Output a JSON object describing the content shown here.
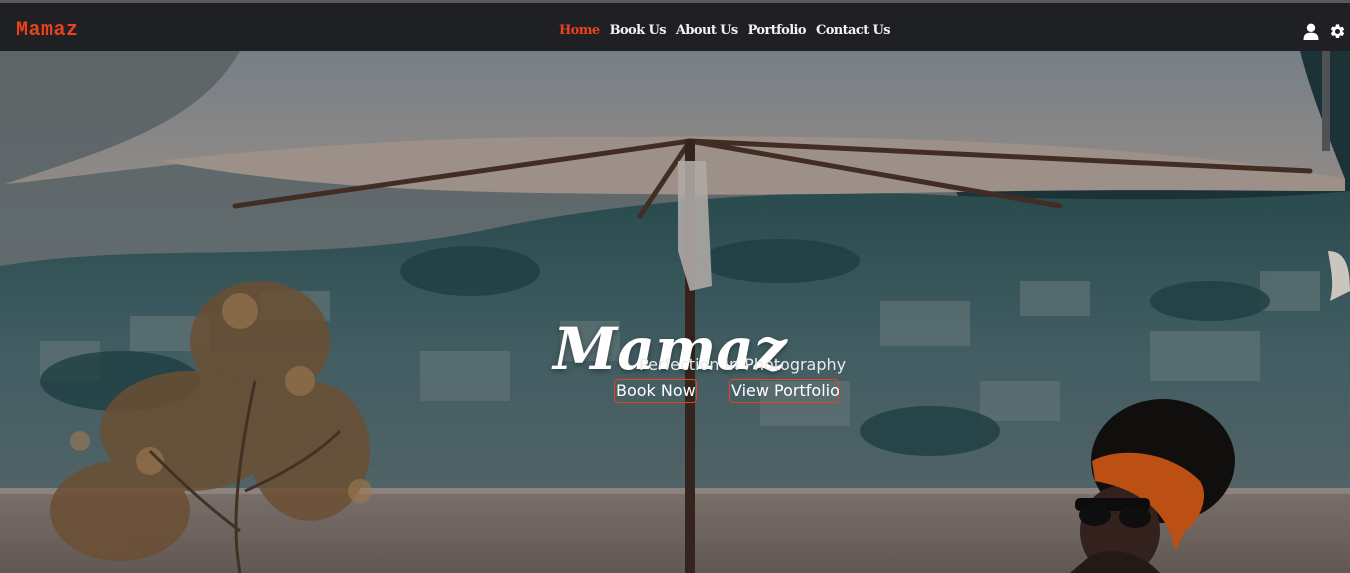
{
  "brand": {
    "name": "Mamaz"
  },
  "nav": {
    "links": [
      {
        "label": "Home",
        "active": true
      },
      {
        "label": "Book Us",
        "active": false
      },
      {
        "label": "About Us",
        "active": false
      },
      {
        "label": "Portfolio",
        "active": false
      },
      {
        "label": "Contact Us",
        "active": false
      }
    ],
    "icons": [
      "user-icon",
      "gear-icon"
    ]
  },
  "hero": {
    "title": "Mamaz",
    "subtitle": "Perfection in Photography",
    "buttons": {
      "book": "Book Now",
      "portfolio": "View Portfolio"
    }
  },
  "colors": {
    "accent": "#e8431c",
    "navbar_bg": "#1f2023",
    "text_light": "#ffffff"
  }
}
